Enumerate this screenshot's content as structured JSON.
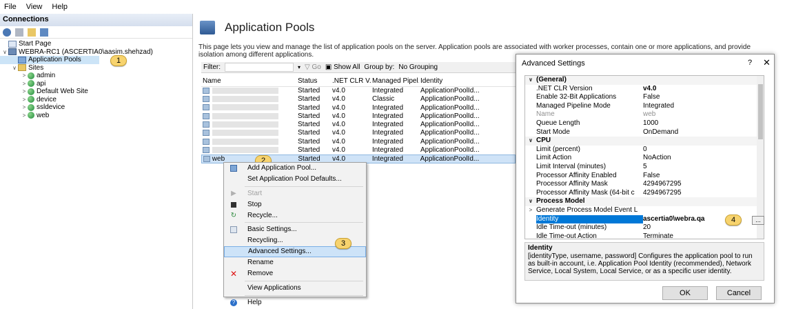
{
  "menu": [
    "File",
    "View",
    "Help"
  ],
  "connections": {
    "header": "Connections",
    "tree": [
      {
        "label": "Start Page"
      },
      {
        "label": "WEBRA-RC1 (ASCERTIA0\\aasim.shehzad)"
      },
      {
        "label": "Application Pools"
      },
      {
        "label": "Sites"
      },
      {
        "label": "admin"
      },
      {
        "label": "api"
      },
      {
        "label": "Default Web Site"
      },
      {
        "label": "device"
      },
      {
        "label": "ssldevice"
      },
      {
        "label": "web"
      }
    ]
  },
  "callouts": [
    "1",
    "2",
    "3",
    "4"
  ],
  "main": {
    "title": "Application Pools",
    "description": "This page lets you view and manage the list of application pools on the server. Application pools are associated with worker processes, contain one or more applications, and provide isolation among different applications.",
    "filter": {
      "label": "Filter:",
      "go": "Go",
      "show_all": "Show All",
      "group_by": "Group by:",
      "group_value": "No Grouping"
    },
    "columns": [
      "Name",
      "Status",
      ".NET CLR V...",
      "Managed Pipel...",
      "Identity"
    ],
    "rows": [
      {
        "name": "",
        "status": "Started",
        "clr": "v4.0",
        "pipeline": "Integrated",
        "identity": "ApplicationPoolId..."
      },
      {
        "name": "",
        "status": "Started",
        "clr": "v4.0",
        "pipeline": "Classic",
        "identity": "ApplicationPoolId..."
      },
      {
        "name": "",
        "status": "Started",
        "clr": "v4.0",
        "pipeline": "Integrated",
        "identity": "ApplicationPoolId..."
      },
      {
        "name": "",
        "status": "Started",
        "clr": "v4.0",
        "pipeline": "Integrated",
        "identity": "ApplicationPoolId..."
      },
      {
        "name": "",
        "status": "Started",
        "clr": "v4.0",
        "pipeline": "Integrated",
        "identity": "ApplicationPoolId..."
      },
      {
        "name": "",
        "status": "Started",
        "clr": "v4.0",
        "pipeline": "Integrated",
        "identity": "ApplicationPoolId..."
      },
      {
        "name": "",
        "status": "Started",
        "clr": "v4.0",
        "pipeline": "Integrated",
        "identity": "ApplicationPoolId..."
      },
      {
        "name": "",
        "status": "Started",
        "clr": "v4.0",
        "pipeline": "Integrated",
        "identity": "ApplicationPoolId..."
      },
      {
        "name": "web",
        "status": "Started",
        "clr": "v4.0",
        "pipeline": "Integrated",
        "identity": "ApplicationPoolId..."
      }
    ]
  },
  "context_menu": [
    {
      "label": "Add Application Pool..."
    },
    {
      "label": "Set Application Pool Defaults..."
    },
    {
      "label": "Start"
    },
    {
      "label": "Stop"
    },
    {
      "label": "Recycle..."
    },
    {
      "label": "Basic Settings..."
    },
    {
      "label": "Recycling..."
    },
    {
      "label": "Advanced Settings..."
    },
    {
      "label": "Rename"
    },
    {
      "label": "Remove"
    },
    {
      "label": "View Applications"
    },
    {
      "label": "Help"
    }
  ],
  "dialog": {
    "title": "Advanced Settings",
    "help": "?",
    "close": "✕",
    "properties": [
      {
        "key": "(General)",
        "value": ""
      },
      {
        "key": ".NET CLR Version",
        "value": "v4.0"
      },
      {
        "key": "Enable 32-Bit Applications",
        "value": "False"
      },
      {
        "key": "Managed Pipeline Mode",
        "value": "Integrated"
      },
      {
        "key": "Name",
        "value": "web"
      },
      {
        "key": "Queue Length",
        "value": "1000"
      },
      {
        "key": "Start Mode",
        "value": "OnDemand"
      },
      {
        "key": "CPU",
        "value": ""
      },
      {
        "key": "Limit (percent)",
        "value": "0"
      },
      {
        "key": "Limit Action",
        "value": "NoAction"
      },
      {
        "key": "Limit Interval (minutes)",
        "value": "5"
      },
      {
        "key": "Processor Affinity Enabled",
        "value": "False"
      },
      {
        "key": "Processor Affinity Mask",
        "value": "4294967295"
      },
      {
        "key": "Processor Affinity Mask (64-bit c",
        "value": "4294967295"
      },
      {
        "key": "Process Model",
        "value": ""
      },
      {
        "key": "Generate Process Model Event L",
        "value": ""
      },
      {
        "key": "Identity",
        "value": "ascertia0\\webra.qa"
      },
      {
        "key": "Idle Time-out (minutes)",
        "value": "20"
      },
      {
        "key": "Idle Time-out Action",
        "value": "Terminate"
      }
    ],
    "dots": "...",
    "desc_title": "Identity",
    "desc_text": "[identityType, username, password] Configures the application pool to run as built-in account, i.e. Application Pool Identity (recommended), Network Service, Local System, Local Service, or as a specific user identity.",
    "ok": "OK",
    "cancel": "Cancel"
  }
}
